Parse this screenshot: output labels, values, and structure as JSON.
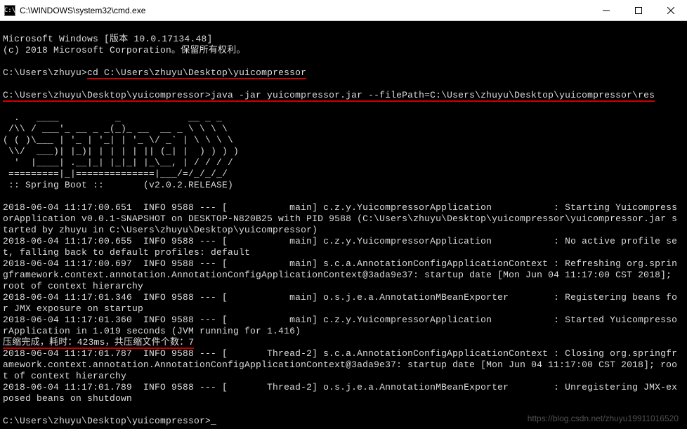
{
  "titlebar": {
    "icon_label": "C:\\",
    "path": "C:\\WINDOWS\\system32\\cmd.exe"
  },
  "terminal": {
    "header_line1": "Microsoft Windows [版本 10.0.17134.48]",
    "header_line2": "(c) 2018 Microsoft Corporation。保留所有权利。",
    "prompt1_pre": "C:\\Users\\zhuyu>",
    "prompt1_cmd": "cd C:\\Users\\zhuyu\\Desktop\\yuicompressor",
    "prompt2_pre": "C:\\Users\\zhuyu\\Desktop\\yuicompressor>",
    "prompt2_cmd": "java -jar yuicompressor.jar --filePath=C:\\Users\\zhuyu\\Desktop\\yuicompressor\\res",
    "spring_banner": [
      "  .   ____          _            __ _ _",
      " /\\\\ / ___'_ __ _ _(_)_ __  __ _ \\ \\ \\ \\",
      "( ( )\\___ | '_ | '_| | '_ \\/ _` | \\ \\ \\ \\",
      " \\\\/  ___)| |_)| | | | | || (_| |  ) ) ) )",
      "  '  |____| .__|_| |_|_| |_\\__, | / / / /",
      " =========|_|==============|___/=/_/_/_/",
      " :: Spring Boot ::       (v2.0.2.RELEASE)"
    ],
    "logs": [
      "2018-06-04 11:17:00.651  INFO 9588 --- [           main] c.z.y.YuicompressorApplication           : Starting Yuicompress",
      "orApplication v0.0.1-SNAPSHOT on DESKTOP-N820B25 with PID 9588 (C:\\Users\\zhuyu\\Desktop\\yuicompressor\\yuicompressor.jar s",
      "tarted by zhuyu in C:\\Users\\zhuyu\\Desktop\\yuicompressor)",
      "2018-06-04 11:17:00.655  INFO 9588 --- [           main] c.z.y.YuicompressorApplication           : No active profile se",
      "t, falling back to default profiles: default",
      "2018-06-04 11:17:00.697  INFO 9588 --- [           main] s.c.a.AnnotationConfigApplicationContext : Refreshing org.sprin",
      "gframework.context.annotation.AnnotationConfigApplicationContext@3ada9e37: startup date [Mon Jun 04 11:17:00 CST 2018]; ",
      "root of context hierarchy",
      "2018-06-04 11:17:01.346  INFO 9588 --- [           main] o.s.j.e.a.AnnotationMBeanExporter        : Registering beans fo",
      "r JMX exposure on startup",
      "2018-06-04 11:17:01.360  INFO 9588 --- [           main] c.z.y.YuicompressorApplication           : Started Yuicompresso",
      "rApplication in 1.019 seconds (JVM running for 1.416)"
    ],
    "highlight_line": "压缩完成，耗时：423ms，共压缩文件个数：7",
    "logs2": [
      "2018-06-04 11:17:01.787  INFO 9588 --- [       Thread-2] s.c.a.AnnotationConfigApplicationContext : Closing org.springfr",
      "amework.context.annotation.AnnotationConfigApplicationContext@3ada9e37: startup date [Mon Jun 04 11:17:00 CST 2018]; roo",
      "t of context hierarchy",
      "2018-06-04 11:17:01.789  INFO 9588 --- [       Thread-2] o.s.j.e.a.AnnotationMBeanExporter        : Unregistering JMX-ex",
      "posed beans on shutdown"
    ],
    "prompt3": "C:\\Users\\zhuyu\\Desktop\\yuicompressor>",
    "cursor": "_"
  },
  "watermark": "https://blog.csdn.net/zhuyu19911016520"
}
